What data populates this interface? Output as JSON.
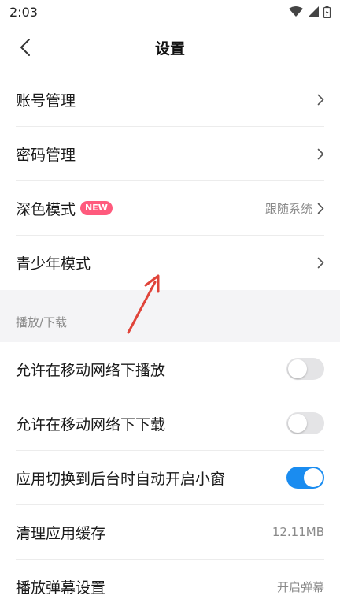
{
  "status_bar": {
    "time": "2:03"
  },
  "header": {
    "title": "设置"
  },
  "settings_rows": [
    {
      "label": "账号管理"
    },
    {
      "label": "密码管理"
    },
    {
      "label": "深色模式",
      "badge": "NEW",
      "value": "跟随系统"
    },
    {
      "label": "青少年模式"
    }
  ],
  "section": {
    "label": "播放/下载"
  },
  "playback_rows": [
    {
      "label": "允许在移动网络下播放",
      "toggle": false
    },
    {
      "label": "允许在移动网络下下载",
      "toggle": false
    },
    {
      "label": "应用切换到后台时自动开启小窗",
      "toggle": true
    },
    {
      "label": "清理应用缓存",
      "value": "12.11MB"
    },
    {
      "label": "播放弹幕设置",
      "value": "开启弹幕"
    }
  ],
  "colors": {
    "accent": "#1a8cf0",
    "badge": "#ff5a7d",
    "annotation_arrow": "#e0443a"
  }
}
